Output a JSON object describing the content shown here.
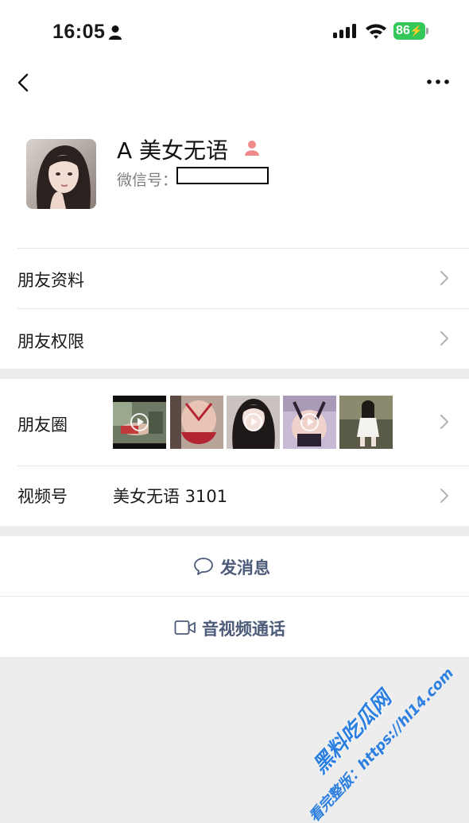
{
  "status_bar": {
    "time": "16:05",
    "battery": "86"
  },
  "profile": {
    "name": "A 美女无语",
    "wechat_id_label": "微信号："
  },
  "rows": {
    "friend_profile": "朋友资料",
    "friend_permissions": "朋友权限",
    "moments": "朋友圈",
    "channels": "视频号",
    "channels_value": "美女无语 3101"
  },
  "actions": {
    "send_message": "发消息",
    "video_call": "音视频通话"
  },
  "watermark": {
    "line1": "黑料吃瓜网",
    "line2": "看完整版：https://hl14.com"
  },
  "icons": {
    "back": "chevron-left-icon",
    "more": "more-dots-icon",
    "chevron": "chevron-right-icon",
    "message": "chat-bubble-icon",
    "video": "video-camera-icon"
  },
  "colors": {
    "action_text": "#4d5b7a",
    "battery": "#34c759",
    "watermark": "#2b7fe0"
  }
}
